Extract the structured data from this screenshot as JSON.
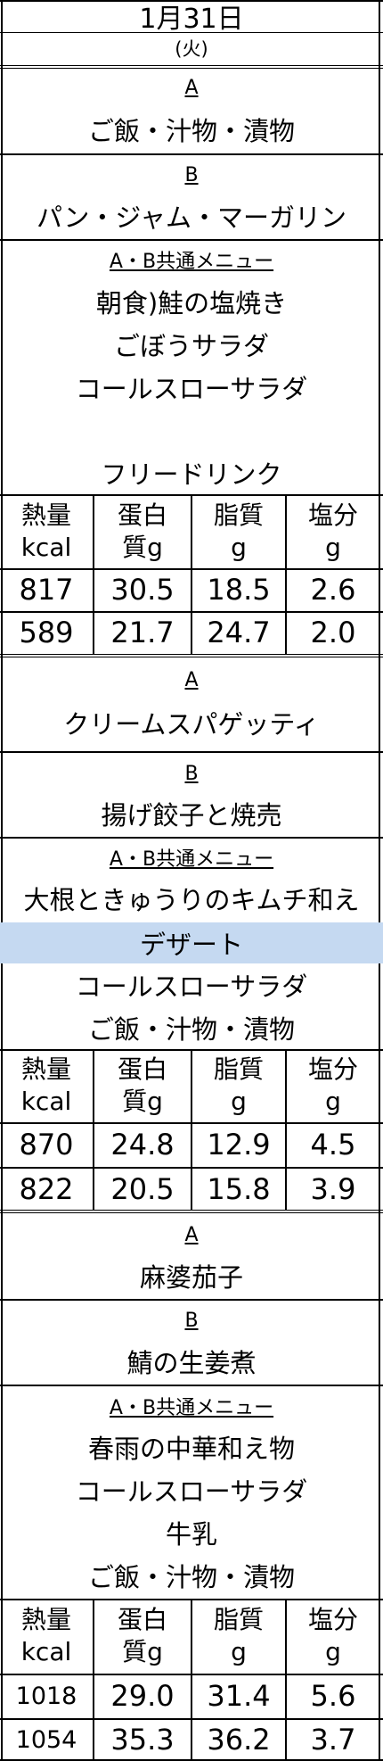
{
  "header": {
    "date": "1月31日",
    "day": "(火)"
  },
  "table_headers": [
    {
      "l1": "熱量",
      "l2": "kcal"
    },
    {
      "l1": "蛋白",
      "l2": "質g"
    },
    {
      "l1": "脂質",
      "l2": "g"
    },
    {
      "l1": "塩分",
      "l2": "g"
    }
  ],
  "breakfast": {
    "a_label": "A",
    "a_items": [
      "ご飯・汁物・漬物"
    ],
    "b_label": "B",
    "b_items": [
      "パン・ジャム・マーガリン"
    ],
    "common_label": "A・B共通メニュー",
    "common_items": [
      "朝食)鮭の塩焼き",
      "ごぼうサラダ",
      "コールスローサラダ",
      "",
      "フリードリンク"
    ],
    "nutrition": [
      [
        "817",
        "30.5",
        "18.5",
        "2.6"
      ],
      [
        "589",
        "21.7",
        "24.7",
        "2.0"
      ]
    ]
  },
  "lunch": {
    "a_label": "A",
    "a_items": [
      "クリームスパゲッティ"
    ],
    "b_label": "B",
    "b_items": [
      "揚げ餃子と焼売"
    ],
    "common_label": "A・B共通メニュー",
    "common_items": [
      "大根ときゅうりのキムチ和え",
      "デザート",
      "コールスローサラダ",
      "ご飯・汁物・漬物"
    ],
    "highlight_color": "#c5d9f1",
    "nutrition": [
      [
        "870",
        "24.8",
        "12.9",
        "4.5"
      ],
      [
        "822",
        "20.5",
        "15.8",
        "3.9"
      ]
    ]
  },
  "dinner": {
    "a_label": "A",
    "a_items": [
      "麻婆茄子"
    ],
    "b_label": "B",
    "b_items": [
      "鯖の生姜煮"
    ],
    "common_label": "A・B共通メニュー",
    "common_items": [
      "春雨の中華和え物",
      "コールスローサラダ",
      "牛乳",
      "ご飯・汁物・漬物"
    ],
    "nutrition": [
      [
        "1018",
        "29.0",
        "31.4",
        "5.6"
      ],
      [
        "1054",
        "35.3",
        "36.2",
        "3.7"
      ]
    ]
  }
}
